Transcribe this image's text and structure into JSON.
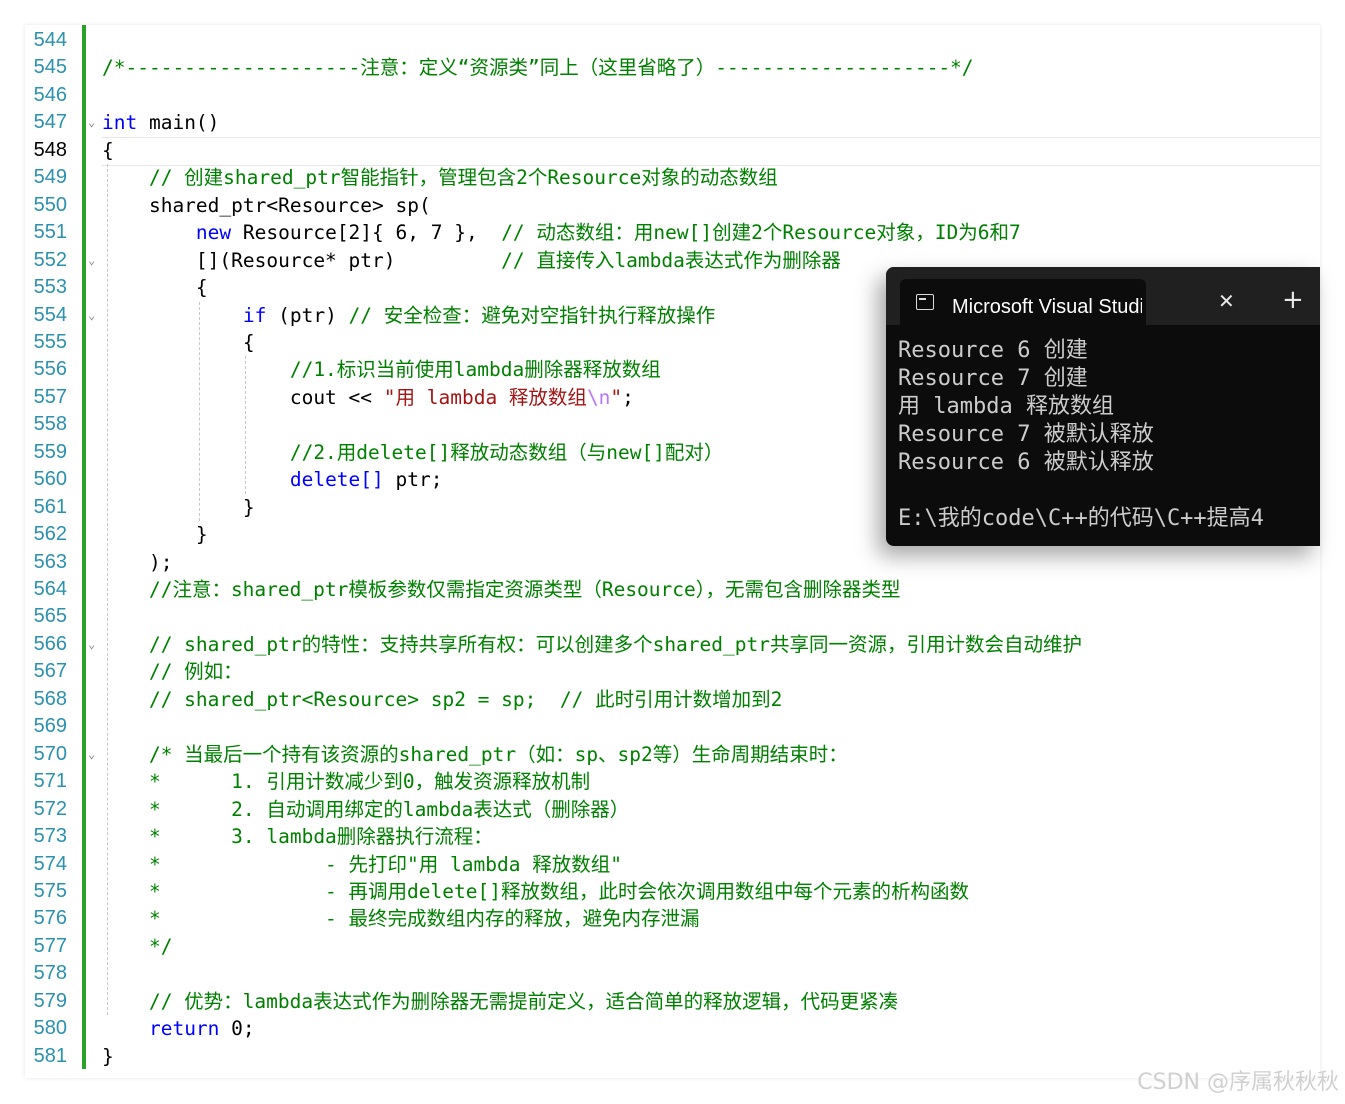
{
  "editor": {
    "current_line": 548,
    "colors": {
      "keyword": "#0000ff",
      "comment": "#008000",
      "string": "#a31515",
      "escape": "#b776fb",
      "line_number": "#2b91af",
      "change_bar": "#2ba02b"
    },
    "lines": [
      {
        "n": 544,
        "fold": false,
        "segments": []
      },
      {
        "n": 545,
        "fold": false,
        "segments": [
          {
            "t": "/*--------------------注意：定义“资源类”同上（这里省略了）--------------------*/",
            "c": "cm"
          }
        ]
      },
      {
        "n": 546,
        "fold": false,
        "segments": []
      },
      {
        "n": 547,
        "fold": true,
        "segments": [
          {
            "t": "int",
            "c": "kw"
          },
          {
            "t": " main()",
            "c": "id"
          }
        ]
      },
      {
        "n": 548,
        "fold": false,
        "segments": [
          {
            "t": "{",
            "c": "id"
          }
        ]
      },
      {
        "n": 549,
        "fold": false,
        "segments": [
          {
            "t": "    // 创建shared_ptr智能指针，管理包含2个Resource对象的动态数组",
            "c": "cm"
          }
        ]
      },
      {
        "n": 550,
        "fold": false,
        "segments": [
          {
            "t": "    shared_ptr<Resource> sp(",
            "c": "id"
          }
        ]
      },
      {
        "n": 551,
        "fold": false,
        "segments": [
          {
            "t": "        ",
            "c": "id"
          },
          {
            "t": "new",
            "c": "kw"
          },
          {
            "t": " Resource[2]{ 6, 7 },  ",
            "c": "id"
          },
          {
            "t": "// 动态数组：用new[]创建2个Resource对象，ID为6和7",
            "c": "cm"
          }
        ]
      },
      {
        "n": 552,
        "fold": true,
        "segments": [
          {
            "t": "        [](Resource* ptr)         ",
            "c": "id"
          },
          {
            "t": "// 直接传入lambda表达式作为删除器",
            "c": "cm"
          }
        ]
      },
      {
        "n": 553,
        "fold": false,
        "segments": [
          {
            "t": "        {",
            "c": "id"
          }
        ]
      },
      {
        "n": 554,
        "fold": true,
        "segments": [
          {
            "t": "            ",
            "c": "id"
          },
          {
            "t": "if",
            "c": "kw"
          },
          {
            "t": " (ptr) ",
            "c": "id"
          },
          {
            "t": "// 安全检查：避免对空指针执行释放操作",
            "c": "cm"
          }
        ]
      },
      {
        "n": 555,
        "fold": false,
        "segments": [
          {
            "t": "            {",
            "c": "id"
          }
        ]
      },
      {
        "n": 556,
        "fold": false,
        "segments": [
          {
            "t": "                //1.标识当前使用lambda删除器释放数组",
            "c": "cm"
          }
        ]
      },
      {
        "n": 557,
        "fold": false,
        "segments": [
          {
            "t": "                cout << ",
            "c": "id"
          },
          {
            "t": "\"用 lambda 释放数组",
            "c": "st"
          },
          {
            "t": "\\n",
            "c": "esc"
          },
          {
            "t": "\"",
            "c": "st"
          },
          {
            "t": ";",
            "c": "id"
          }
        ]
      },
      {
        "n": 558,
        "fold": false,
        "segments": []
      },
      {
        "n": 559,
        "fold": false,
        "segments": [
          {
            "t": "                //2.用delete[]释放动态数组（与new[]配对）",
            "c": "cm"
          }
        ]
      },
      {
        "n": 560,
        "fold": false,
        "segments": [
          {
            "t": "                ",
            "c": "id"
          },
          {
            "t": "delete[]",
            "c": "kw"
          },
          {
            "t": " ptr;",
            "c": "id"
          }
        ]
      },
      {
        "n": 561,
        "fold": false,
        "segments": [
          {
            "t": "            }",
            "c": "id"
          }
        ]
      },
      {
        "n": 562,
        "fold": false,
        "segments": [
          {
            "t": "        }",
            "c": "id"
          }
        ]
      },
      {
        "n": 563,
        "fold": false,
        "segments": [
          {
            "t": "    );",
            "c": "id"
          }
        ]
      },
      {
        "n": 564,
        "fold": false,
        "segments": [
          {
            "t": "    //注意：shared_ptr模板参数仅需指定资源类型（Resource），无需包含删除器类型",
            "c": "cm"
          }
        ]
      },
      {
        "n": 565,
        "fold": false,
        "segments": []
      },
      {
        "n": 566,
        "fold": true,
        "segments": [
          {
            "t": "    // shared_ptr的特性：支持共享所有权：可以创建多个shared_ptr共享同一资源，引用计数会自动维护",
            "c": "cm"
          }
        ]
      },
      {
        "n": 567,
        "fold": false,
        "segments": [
          {
            "t": "    // 例如：",
            "c": "cm"
          }
        ]
      },
      {
        "n": 568,
        "fold": false,
        "segments": [
          {
            "t": "    // shared_ptr<Resource> sp2 = sp;  // 此时引用计数增加到2",
            "c": "cm"
          }
        ]
      },
      {
        "n": 569,
        "fold": false,
        "segments": []
      },
      {
        "n": 570,
        "fold": true,
        "segments": [
          {
            "t": "    /* 当最后一个持有该资源的shared_ptr（如：sp、sp2等）生命周期结束时：",
            "c": "cm"
          }
        ]
      },
      {
        "n": 571,
        "fold": false,
        "segments": [
          {
            "t": "    *      1. 引用计数减少到0，触发资源释放机制",
            "c": "cm"
          }
        ]
      },
      {
        "n": 572,
        "fold": false,
        "segments": [
          {
            "t": "    *      2. 自动调用绑定的lambda表达式（删除器）",
            "c": "cm"
          }
        ]
      },
      {
        "n": 573,
        "fold": false,
        "segments": [
          {
            "t": "    *      3. lambda删除器执行流程：",
            "c": "cm"
          }
        ]
      },
      {
        "n": 574,
        "fold": false,
        "segments": [
          {
            "t": "    *              - 先打印\"用 lambda 释放数组\"",
            "c": "cm"
          }
        ]
      },
      {
        "n": 575,
        "fold": false,
        "segments": [
          {
            "t": "    *              - 再调用delete[]释放数组，此时会依次调用数组中每个元素的析构函数",
            "c": "cm"
          }
        ]
      },
      {
        "n": 576,
        "fold": false,
        "segments": [
          {
            "t": "    *              - 最终完成数组内存的释放，避免内存泄漏",
            "c": "cm"
          }
        ]
      },
      {
        "n": 577,
        "fold": false,
        "segments": [
          {
            "t": "    */",
            "c": "cm"
          }
        ]
      },
      {
        "n": 578,
        "fold": false,
        "segments": []
      },
      {
        "n": 579,
        "fold": false,
        "segments": [
          {
            "t": "    // 优势：lambda表达式作为删除器无需提前定义，适合简单的释放逻辑，代码更紧凑",
            "c": "cm"
          }
        ]
      },
      {
        "n": 580,
        "fold": false,
        "segments": [
          {
            "t": "    ",
            "c": "id"
          },
          {
            "t": "return",
            "c": "kw"
          },
          {
            "t": " 0;",
            "c": "id"
          }
        ]
      },
      {
        "n": 581,
        "fold": false,
        "segments": [
          {
            "t": "}",
            "c": "id"
          }
        ]
      }
    ]
  },
  "console": {
    "title": "Microsoft Visual Studio 调试控制台",
    "close_icon": "close-icon",
    "new_tab_icon": "plus-icon",
    "lines": [
      "Resource 6 创建",
      "Resource 7 创建",
      "用 lambda 释放数组",
      "Resource 7 被默认释放",
      "Resource 6 被默认释放",
      "",
      "E:\\我的code\\C++的代码\\C++提高4"
    ]
  },
  "watermark": "CSDN @序属秋秋秋"
}
